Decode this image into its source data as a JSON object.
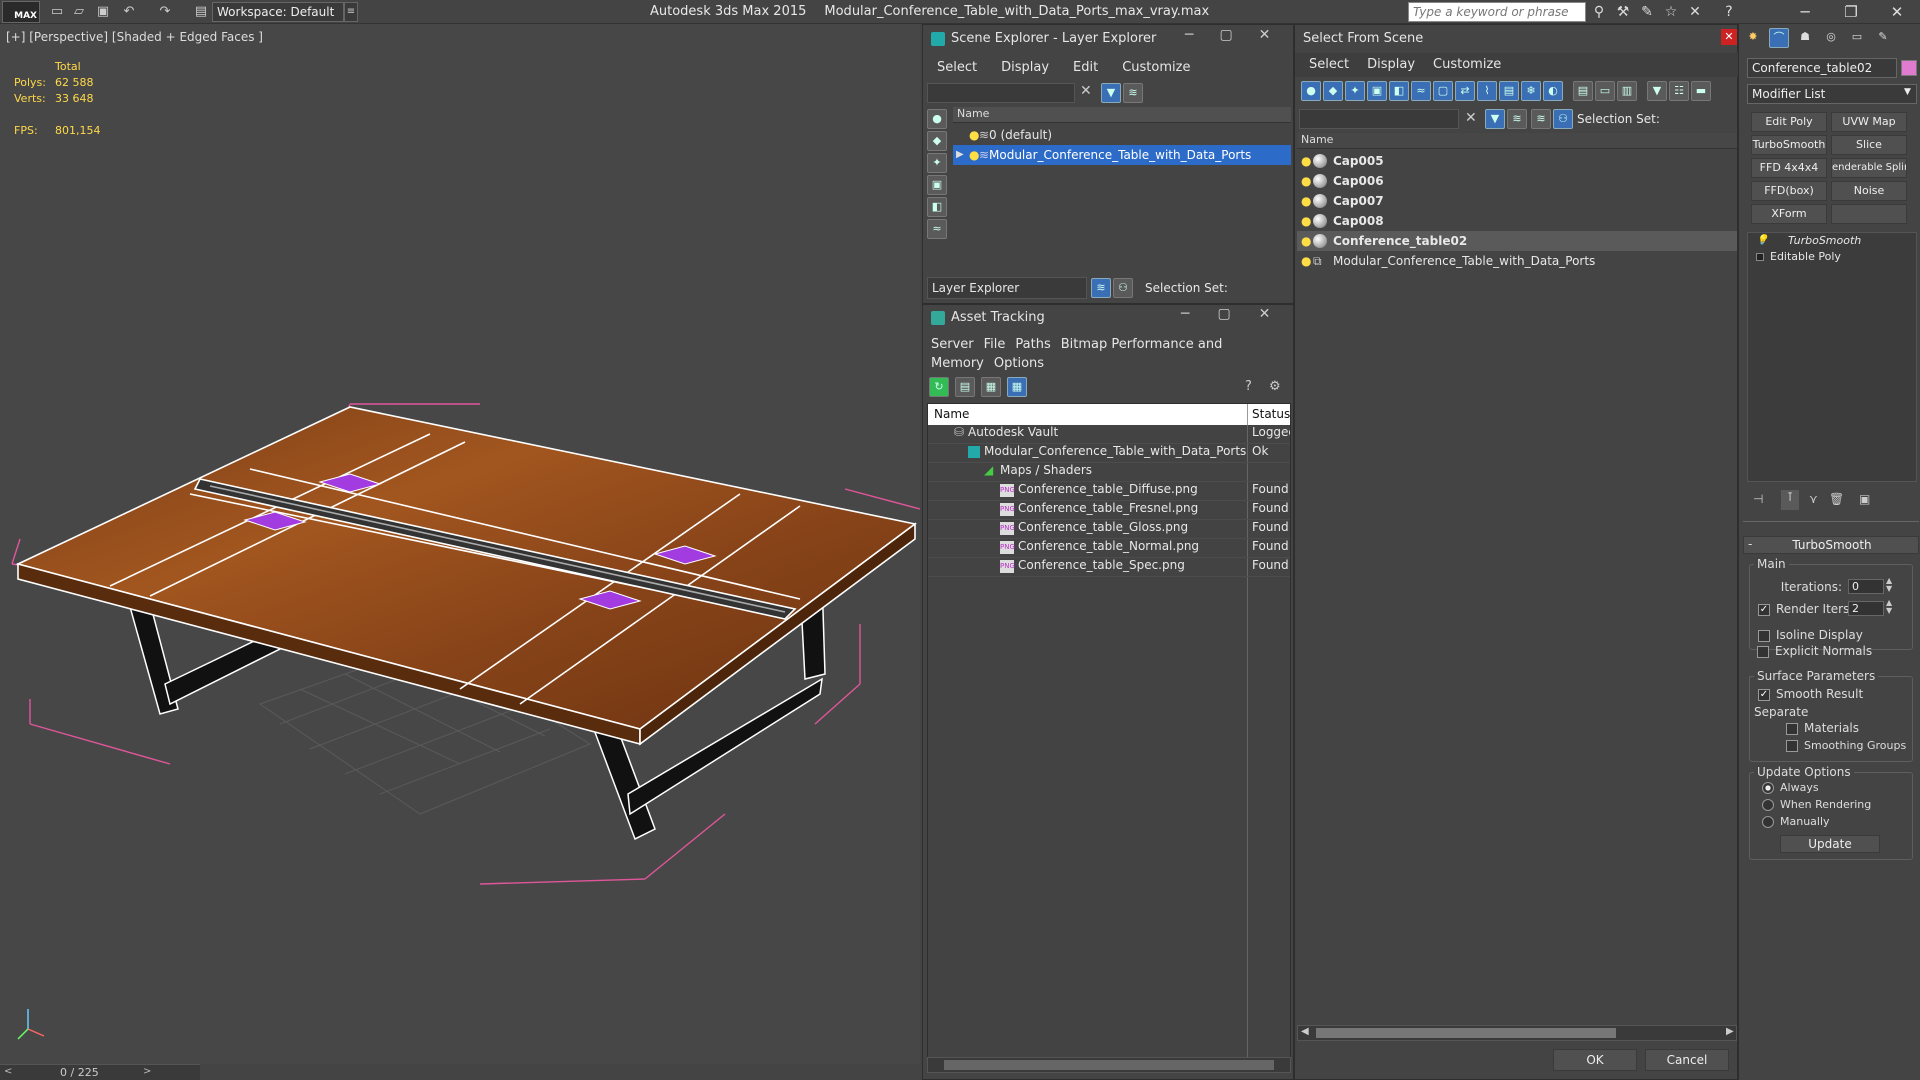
{
  "app": {
    "title": "Autodesk 3ds Max  2015",
    "file": "Modular_Conference_Table_with_Data_Ports_max_vray.max",
    "logo": "MAX",
    "workspace": "Workspace: Default",
    "search_placeholder": "Type a keyword or phrase"
  },
  "viewport": {
    "label": "[+] [Perspective] [Shaded + Edged Faces ]",
    "stats": {
      "total_label": "Total",
      "polys_label": "Polys:",
      "polys": "62 588",
      "verts_label": "Verts:",
      "verts": "33 648",
      "fps_label": "FPS:",
      "fps": "801,154"
    }
  },
  "timeline": {
    "frame": "0 / 225"
  },
  "scene_explorer": {
    "title": "Scene Explorer - Layer Explorer",
    "menu": [
      "Select",
      "Display",
      "Edit",
      "Customize"
    ],
    "column": "Name",
    "layers": [
      "0 (default)",
      "Modular_Conference_Table_with_Data_Ports"
    ],
    "footer_dropdown": "Layer Explorer",
    "selection_set": "Selection Set:"
  },
  "asset_tracking": {
    "title": "Asset Tracking",
    "menu": [
      "Server",
      "File",
      "Paths",
      "Bitmap Performance and Memory",
      "Options"
    ],
    "col_name": "Name",
    "col_status": "Status",
    "rows": [
      {
        "name": "Autodesk Vault",
        "status": "Logged"
      },
      {
        "name": "Modular_Conference_Table_with_Data_Ports_m...",
        "status": "Ok"
      },
      {
        "name": "Maps / Shaders",
        "status": ""
      },
      {
        "name": "Conference_table_Diffuse.png",
        "status": "Found"
      },
      {
        "name": "Conference_table_Fresnel.png",
        "status": "Found"
      },
      {
        "name": "Conference_table_Gloss.png",
        "status": "Found"
      },
      {
        "name": "Conference_table_Normal.png",
        "status": "Found"
      },
      {
        "name": "Conference_table_Spec.png",
        "status": "Found"
      }
    ]
  },
  "select_from_scene": {
    "title": "Select From Scene",
    "menu": [
      "Select",
      "Display",
      "Customize"
    ],
    "selection_set": "Selection Set:",
    "column": "Name",
    "items": [
      "Cap005",
      "Cap006",
      "Cap007",
      "Cap008",
      "Conference_table02",
      "Modular_Conference_Table_with_Data_Ports"
    ],
    "ok": "OK",
    "cancel": "Cancel"
  },
  "command_panel": {
    "object_name": "Conference_table02",
    "modifier_list": "Modifier List",
    "mod_buttons": [
      "Edit Poly",
      "UVW Map",
      "TurboSmooth",
      "Slice",
      "FFD 4x4x4",
      "enderable Splin",
      "FFD(box)",
      "Noise",
      "XForm",
      ""
    ],
    "stack": [
      "TurboSmooth",
      "Editable Poly"
    ],
    "rollout": "TurboSmooth",
    "main": "Main",
    "iterations_label": "Iterations:",
    "iterations": "0",
    "render_iters_label": "Render Iters:",
    "render_iters": "2",
    "isoline": "Isoline Display",
    "explicit": "Explicit Normals",
    "surface": "Surface Parameters",
    "smooth_result": "Smooth Result",
    "separate": "Separate",
    "materials": "Materials",
    "smoothing_groups": "Smoothing Groups",
    "update_options": "Update Options",
    "always": "Always",
    "when_rendering": "When Rendering",
    "manually": "Manually",
    "update": "Update"
  },
  "colors": {
    "accent": "#2c6bc7",
    "stats": "#ffd94a",
    "selection_bounds": "#e0569a"
  }
}
